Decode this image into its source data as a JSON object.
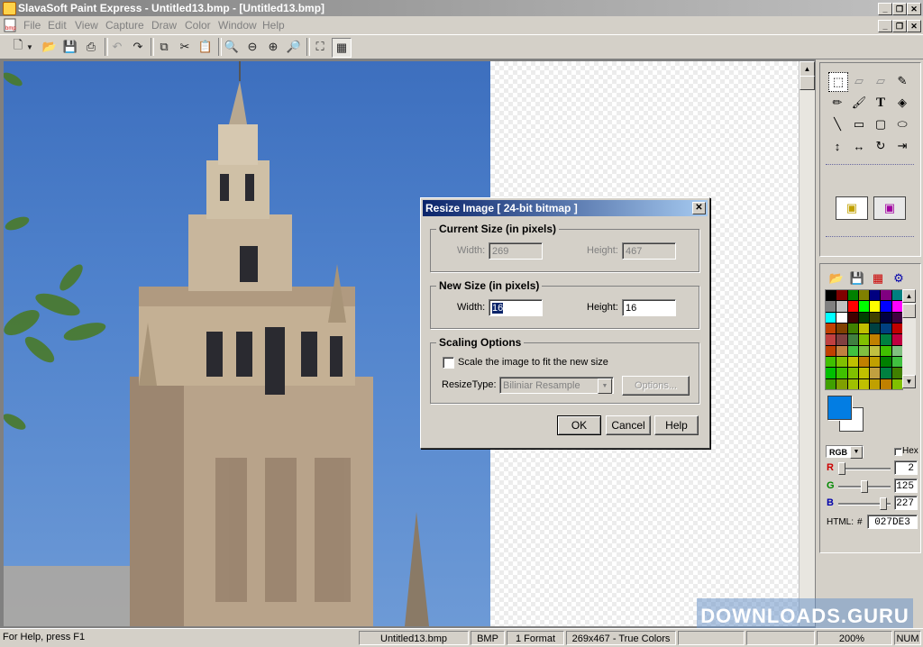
{
  "window": {
    "title": "SlavaSoft Paint Express - Untitled13.bmp - [Untitled13.bmp]"
  },
  "menu": [
    "File",
    "Edit",
    "View",
    "Capture",
    "Draw",
    "Color",
    "Window",
    "Help"
  ],
  "toolbar": {
    "icons": [
      "new-icon",
      "open-icon",
      "save-icon",
      "print-icon",
      "undo-icon",
      "redo-icon",
      "copy-icon",
      "cut-icon",
      "paste-icon",
      "zoom-actual-icon",
      "zoom-out-icon",
      "zoom-in-icon",
      "zoom-fit-icon",
      "crop-icon",
      "grid-icon"
    ]
  },
  "dialog": {
    "title": "Resize Image [ 24-bit bitmap ]",
    "current_size": {
      "label": "Current Size (in pixels)",
      "width_label": "Width:",
      "width": "269",
      "height_label": "Height:",
      "height": "467"
    },
    "new_size": {
      "label": "New Size (in pixels)",
      "width_label": "Width:",
      "width": "16",
      "height_label": "Height:",
      "height": "16"
    },
    "scaling": {
      "label": "Scaling Options",
      "checkbox_label": "Scale the image to fit the new size",
      "checked": false,
      "resize_type_label": "ResizeType:",
      "resize_type": "Biliniar Resample",
      "options_button": "Options..."
    },
    "ok": "OK",
    "cancel": "Cancel",
    "help": "Help"
  },
  "color_panel": {
    "mode": "RGB",
    "hex_label": "Hex",
    "r_label": "R",
    "r": "2",
    "g_label": "G",
    "g": "125",
    "b_label": "B",
    "b": "227",
    "html_label": "HTML:",
    "hash": "#",
    "html": "027DE3",
    "r_value": 2,
    "g_value": 125,
    "b_value": 227,
    "foreground": "#027de3",
    "background": "#ffffff",
    "palette": [
      "#000000",
      "#800000",
      "#008000",
      "#808000",
      "#000080",
      "#800080",
      "#008080",
      "#808080",
      "#c0c0c0",
      "#ff0000",
      "#00ff00",
      "#ffff00",
      "#0000ff",
      "#ff00ff",
      "#00ffff",
      "#ffffff",
      "#400000",
      "#004000",
      "#404000",
      "#000040",
      "#400040",
      "#c04000",
      "#804000",
      "#408000",
      "#c0c000",
      "#004040",
      "#004080",
      "#c00000",
      "#c04040",
      "#804040",
      "#408040",
      "#80c000",
      "#c08000",
      "#008040",
      "#c00040",
      "#c04000",
      "#c08040",
      "#40c040",
      "#80c040",
      "#c0c040",
      "#40c000",
      "#80c080",
      "#40c000",
      "#80c000",
      "#c0c000",
      "#c08000",
      "#c0a000",
      "#008000",
      "#40c040",
      "#00c000",
      "#40c000",
      "#80c000",
      "#c0c000",
      "#c0a040",
      "#008040",
      "#408000",
      "#40a000",
      "#80a000",
      "#a0c000",
      "#c0c000",
      "#c0a000",
      "#c08000",
      "#80c000"
    ]
  },
  "status": {
    "help": "For Help, press F1",
    "file": "Untitled13.bmp",
    "format": "BMP",
    "frames": "1 Format",
    "info": "269x467 - True Colors",
    "zoom": "200%",
    "num": "NUM"
  },
  "watermark": "DOWNLOADS.GURU"
}
